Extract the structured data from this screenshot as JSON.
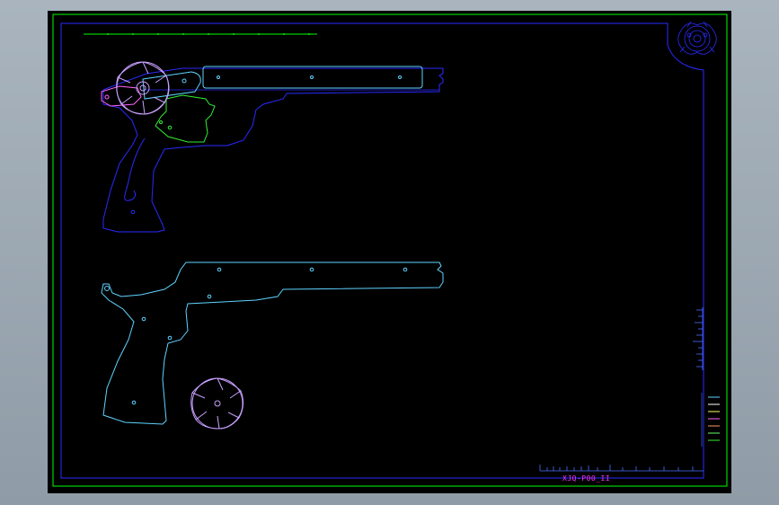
{
  "drawing": {
    "label": "XJQ-P00_II"
  },
  "colors": {
    "background": "#000000",
    "outer_frame": "#00ff00",
    "inner_frame": "#2a2aff",
    "part_outline": "#3a8cff",
    "cylinder": "#c9a0ff",
    "slide": "#5fd3ff",
    "grip_plate": "#33ee33",
    "pin": "#ff66ff",
    "label": "#ff33ff"
  },
  "icons": {
    "logo": "ornament-logo-icon"
  }
}
